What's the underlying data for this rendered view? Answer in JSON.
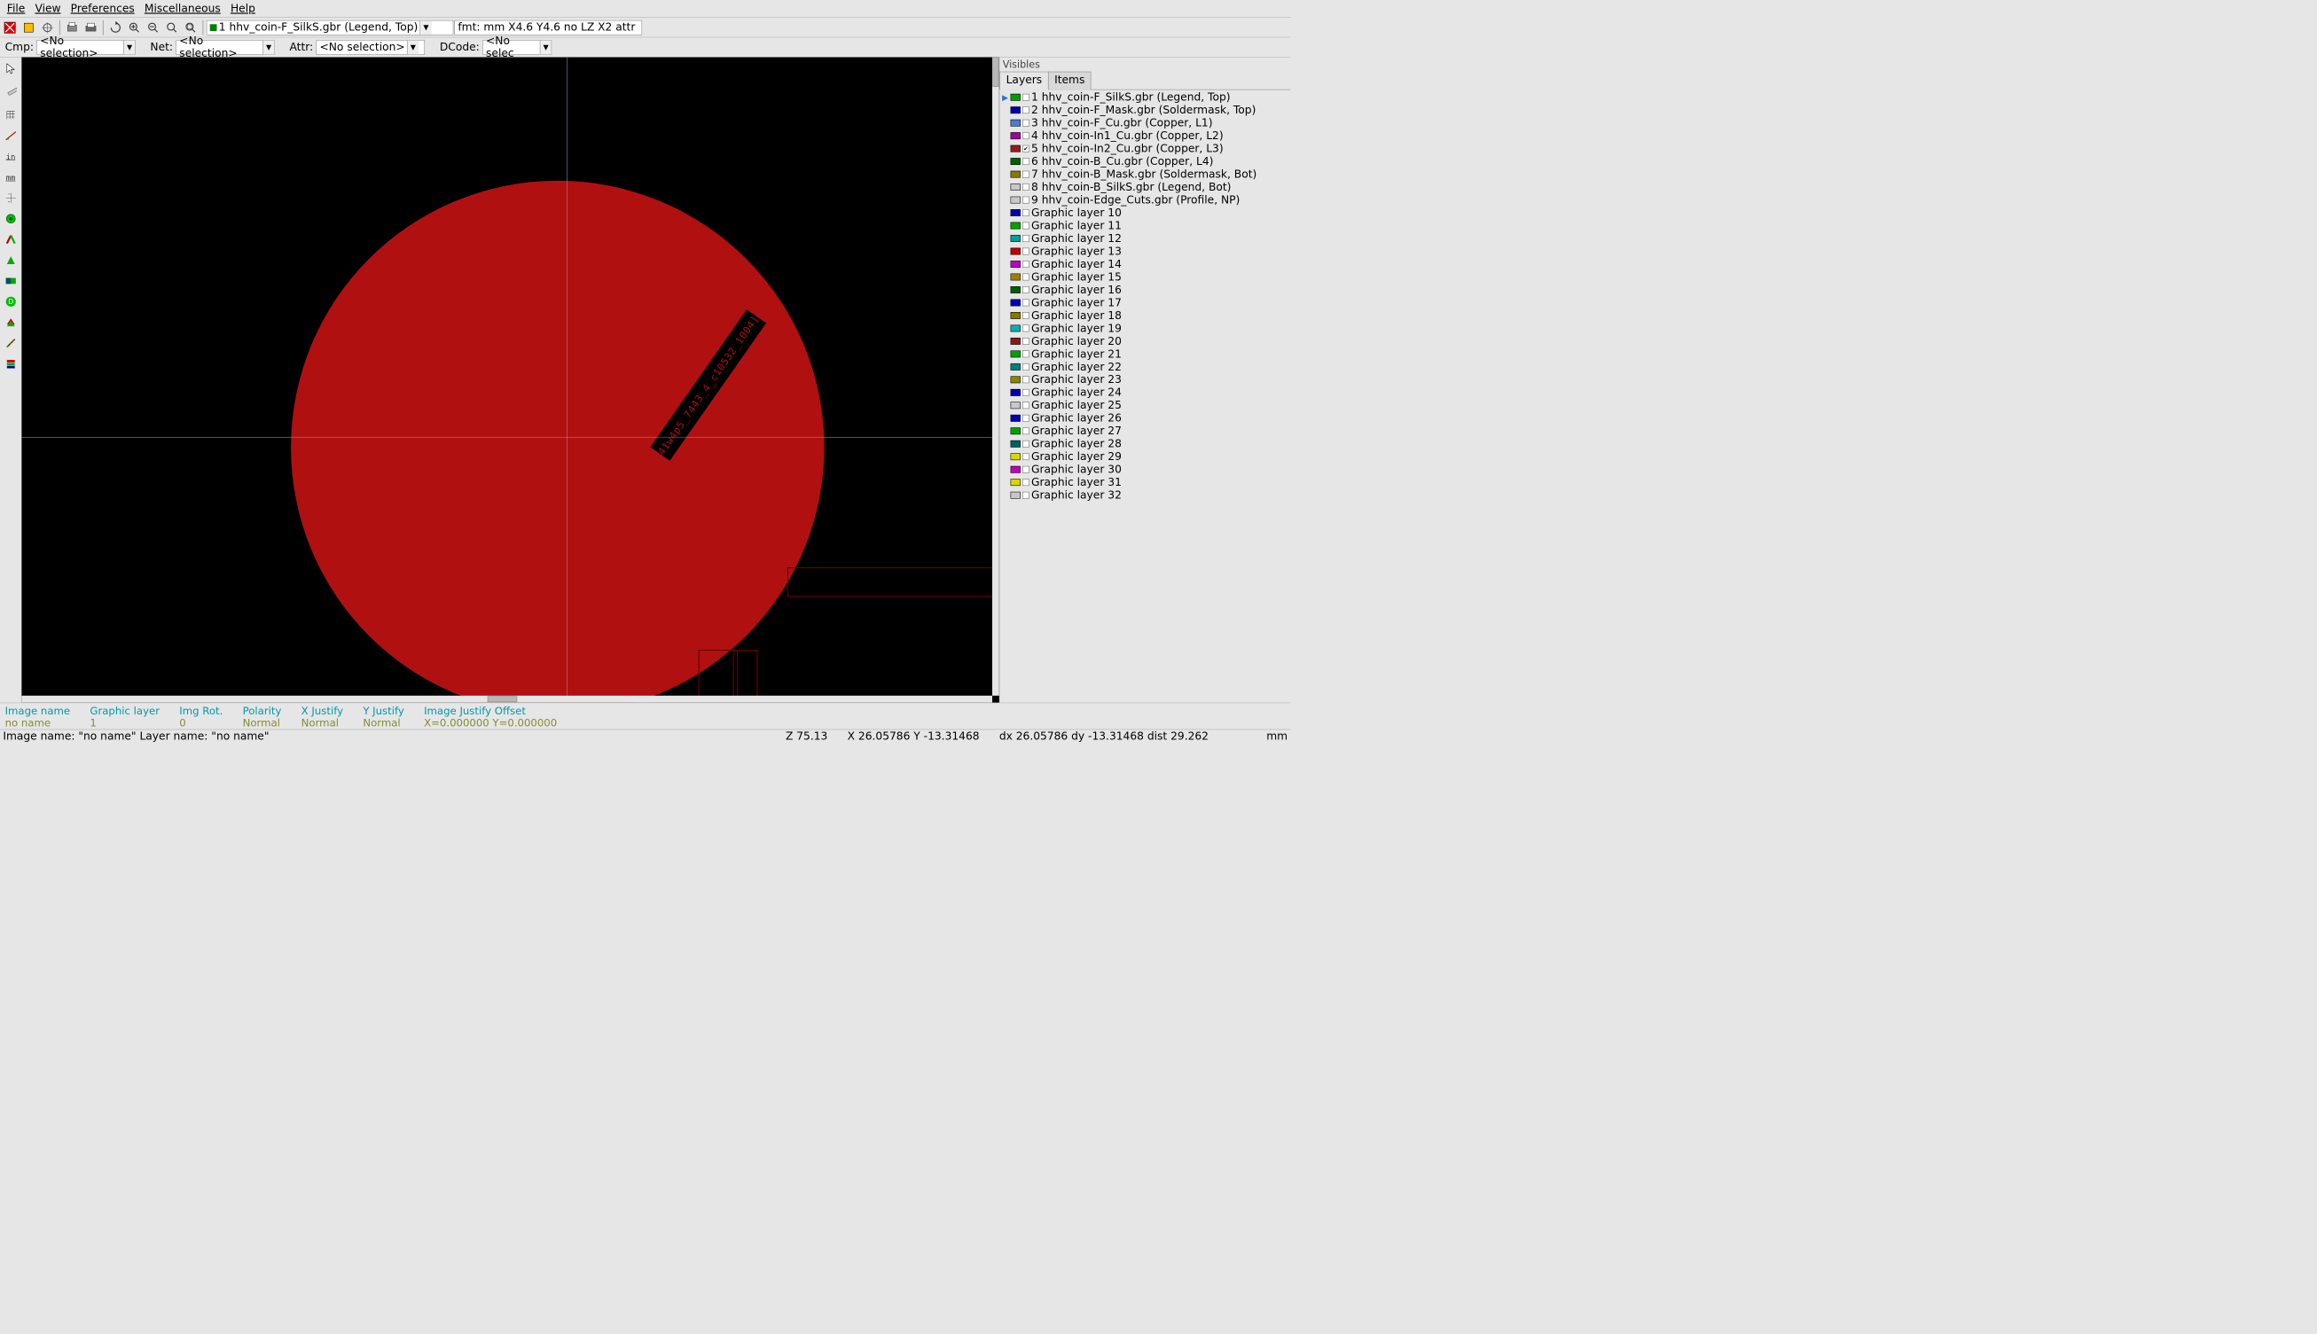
{
  "menu": {
    "file": "File",
    "view": "View",
    "prefs": "Preferences",
    "misc": "Miscellaneous",
    "help": "Help"
  },
  "toolbar1": {
    "layer_select": "1 hhv_coin-F_SilkS.gbr (Legend, Top)",
    "fmt": "fmt: mm X4.6 Y4.6 no LZ X2 attr"
  },
  "filters": {
    "cmp": {
      "label": "Cmp:",
      "value": "<No selection>"
    },
    "net": {
      "label": "Net:",
      "value": "<No selection>"
    },
    "attr": {
      "label": "Attr:",
      "value": "<No selection>"
    },
    "dcode": {
      "label": "DCode:",
      "value": "<No selec"
    }
  },
  "canvas": {
    "text": "41w4p5_7443_4_c10532_1004]"
  },
  "visibles": {
    "title": "Visibles",
    "tab_layers": "Layers",
    "tab_items": "Items"
  },
  "layers": [
    {
      "n": "1",
      "name": "hhv_coin-F_SilkS.gbr (Legend, Top)",
      "color": "#00a000",
      "checked": false,
      "active": true
    },
    {
      "n": "2",
      "name": "hhv_coin-F_Mask.gbr (Soldermask, Top)",
      "color": "#0000b0",
      "checked": false
    },
    {
      "n": "3",
      "name": "hhv_coin-F_Cu.gbr (Copper, L1)",
      "color": "#4a7fc8",
      "checked": false
    },
    {
      "n": "4",
      "name": "hhv_coin-In1_Cu.gbr (Copper, L2)",
      "color": "#a000a0",
      "checked": false
    },
    {
      "n": "5",
      "name": "hhv_coin-In2_Cu.gbr (Copper, L3)",
      "color": "#9a1a1a",
      "checked": true
    },
    {
      "n": "6",
      "name": "hhv_coin-B_Cu.gbr (Copper, L4)",
      "color": "#006000",
      "checked": false
    },
    {
      "n": "7",
      "name": "hhv_coin-B_Mask.gbr (Soldermask, Bot)",
      "color": "#887700",
      "checked": false
    },
    {
      "n": "8",
      "name": "hhv_coin-B_SilkS.gbr (Legend, Bot)",
      "color": "#c8c8c8",
      "checked": false
    },
    {
      "n": "9",
      "name": "hhv_coin-Edge_Cuts.gbr (Profile, NP)",
      "color": "#c8c8c8",
      "checked": false
    },
    {
      "n": "",
      "name": "Graphic layer 10",
      "color": "#0000b0",
      "checked": false
    },
    {
      "n": "",
      "name": "Graphic layer 11",
      "color": "#00a000",
      "checked": false
    },
    {
      "n": "",
      "name": "Graphic layer 12",
      "color": "#00a0a0",
      "checked": false
    },
    {
      "n": "",
      "name": "Graphic layer 13",
      "color": "#c00000",
      "checked": false
    },
    {
      "n": "",
      "name": "Graphic layer 14",
      "color": "#c000c0",
      "checked": false
    },
    {
      "n": "",
      "name": "Graphic layer 15",
      "color": "#a08000",
      "checked": false
    },
    {
      "n": "",
      "name": "Graphic layer 16",
      "color": "#006000",
      "checked": false
    },
    {
      "n": "",
      "name": "Graphic layer 17",
      "color": "#0000b0",
      "checked": false
    },
    {
      "n": "",
      "name": "Graphic layer 18",
      "color": "#887700",
      "checked": false
    },
    {
      "n": "",
      "name": "Graphic layer 19",
      "color": "#00b0b0",
      "checked": false
    },
    {
      "n": "",
      "name": "Graphic layer 20",
      "color": "#8a1a1a",
      "checked": false
    },
    {
      "n": "",
      "name": "Graphic layer 21",
      "color": "#00a000",
      "checked": false
    },
    {
      "n": "",
      "name": "Graphic layer 22",
      "color": "#008080",
      "checked": false
    },
    {
      "n": "",
      "name": "Graphic layer 23",
      "color": "#888800",
      "checked": false
    },
    {
      "n": "",
      "name": "Graphic layer 24",
      "color": "#0000b0",
      "checked": false
    },
    {
      "n": "",
      "name": "Graphic layer 25",
      "color": "#c8c8c8",
      "checked": false
    },
    {
      "n": "",
      "name": "Graphic layer 26",
      "color": "#0000b0",
      "checked": false
    },
    {
      "n": "",
      "name": "Graphic layer 27",
      "color": "#00a000",
      "checked": false
    },
    {
      "n": "",
      "name": "Graphic layer 28",
      "color": "#006060",
      "checked": false
    },
    {
      "n": "",
      "name": "Graphic layer 29",
      "color": "#d8d800",
      "checked": false
    },
    {
      "n": "",
      "name": "Graphic layer 30",
      "color": "#c000c0",
      "checked": false
    },
    {
      "n": "",
      "name": "Graphic layer 31",
      "color": "#d8d800",
      "checked": false
    },
    {
      "n": "",
      "name": "Graphic layer 32",
      "color": "#c8c8c8",
      "checked": false
    }
  ],
  "info": [
    {
      "h": "Image name",
      "v": "no name"
    },
    {
      "h": "Graphic layer",
      "v": "1"
    },
    {
      "h": "Img Rot.",
      "v": "0"
    },
    {
      "h": "Polarity",
      "v": "Normal"
    },
    {
      "h": "X Justify",
      "v": "Normal"
    },
    {
      "h": "Y Justify",
      "v": "Normal"
    },
    {
      "h": "Image Justify Offset",
      "v": "X=0.000000 Y=0.000000"
    }
  ],
  "status": {
    "imgname": "Image name: \"no name\"  Layer name: \"no name\"",
    "z": "Z 75.13",
    "xy": "X 26.05786  Y -13.31468",
    "dxy": "dx 26.05786  dy -13.31468  dist 29.262",
    "unit": "mm"
  }
}
